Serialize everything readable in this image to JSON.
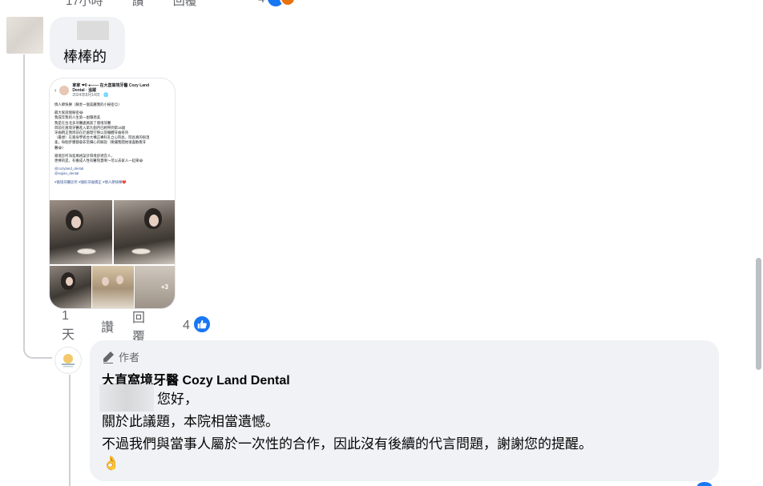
{
  "top_row": {
    "time": "17小時",
    "like": "讚",
    "reply": "回覆",
    "count": "4"
  },
  "comment": {
    "text": "棒棒的",
    "screenshot": {
      "header_name": "家家 ❤0 ●—— 在大直窩境牙醫 Cozy Land Dental · 追蹤",
      "header_date": "2024年8月14日 · 🌐",
      "lines": [
        "情人節快樂（蘇金一個美麗我的小秘密😊）",
        "",
        "最大家說個秘密😂",
        "我成年我的人生第一副隱適美",
        "我是在台北多牙醫處員族了窩境牙醫",
        "目前在窩境牙醫進入第九個月已經帶到第16副",
        "牙齒稍正我目前在於處理空隙以及髓體牙齒排列",
        "（最想）在窩身學者台大構正專科孔立心院長，院長真的很溫",
        "柔，每個步驟都會非常細心的解說（要讓我開始很喜歡看牙",
        "醫😂）",
        "",
        "窩境診所海島風格設計環境舒適宜人，",
        "更棒的是，有養成人性有醫院蓋啊～可以去家人一起來😂",
        "",
        "@cozyland_dental",
        "@sojian_dental",
        "",
        "#窩境牙醫診所 #隱形牙齒矯正 #情人節快樂❤️"
      ],
      "more_photos": "+3"
    },
    "actions": {
      "time": "1天",
      "like": "讚",
      "reply": "回覆",
      "count": "4"
    }
  },
  "reply": {
    "author_tag": "作者",
    "author_name": "大直窩境牙醫 Cozy Land Dental",
    "line1": "您好，",
    "line2": "關於此議題，本院相當遺憾。",
    "line3": "不過我們與當事人屬於一次性的合作，因此沒有後續的代言問題，謝謝您的提醒。",
    "emoji": "👌"
  },
  "colors": {
    "bubble": "#f0f2f5",
    "secondary_text": "#65676b",
    "like_blue": "#1877f2",
    "link_blue": "#385898"
  }
}
